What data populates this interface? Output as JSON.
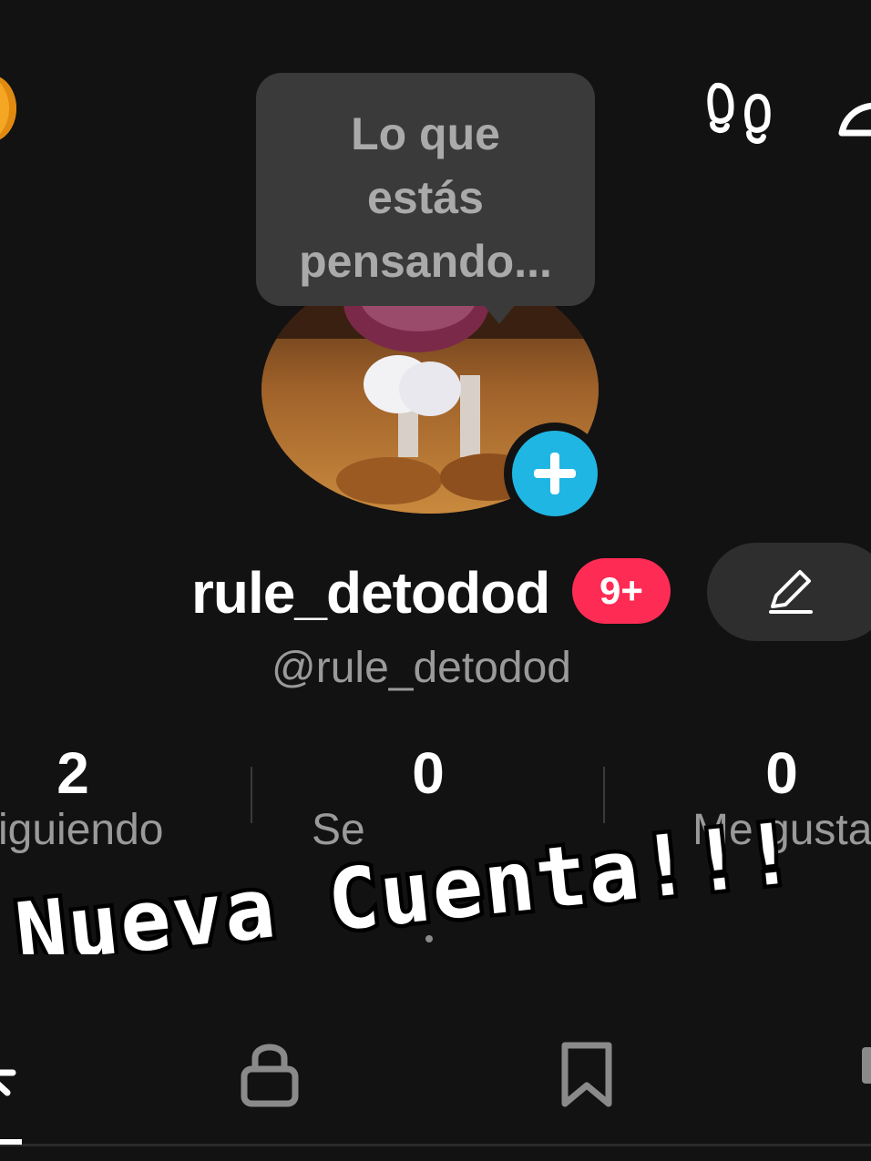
{
  "tooltip": {
    "line1": "Lo que",
    "line2": "estás",
    "line3": "pensando..."
  },
  "profile": {
    "username": "rule_detodod",
    "handle": "@rule_detodod",
    "notification_badge": "9+"
  },
  "stats": [
    {
      "value": "2",
      "label": "iguiendo"
    },
    {
      "value": "0",
      "label": "Se"
    },
    {
      "value": "0",
      "label": "Me gusta"
    }
  ],
  "overlay": {
    "text": "Nueva Cuenta!!!"
  },
  "icons": {
    "coin": "coin-icon",
    "footprints": "footprints-icon",
    "share": "share-icon",
    "add": "plus-icon",
    "edit": "pencil-icon",
    "videos": "videos-icon",
    "private": "lock-icon",
    "saved": "bookmark-icon"
  },
  "colors": {
    "background": "#121212",
    "accent_red": "#fe2c55",
    "accent_blue": "#20b6e3"
  }
}
